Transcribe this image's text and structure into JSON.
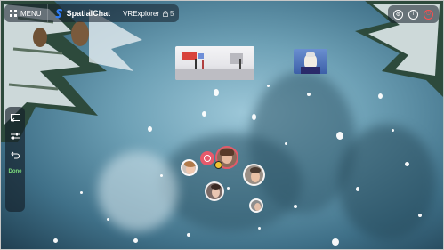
{
  "topbar": {
    "menu_label": "MENU",
    "brand_name": "SpatialChat",
    "space_name": "VRExplorer",
    "participants_count": "5"
  },
  "right_controls": {
    "icons": [
      "settings-icon",
      "info-icon",
      "power-icon"
    ],
    "power_color": "#ff4d4d"
  },
  "left_toolbar": {
    "done_label": "Done",
    "done_color": "#7fe07f"
  },
  "accent_color": "#e65a6c"
}
